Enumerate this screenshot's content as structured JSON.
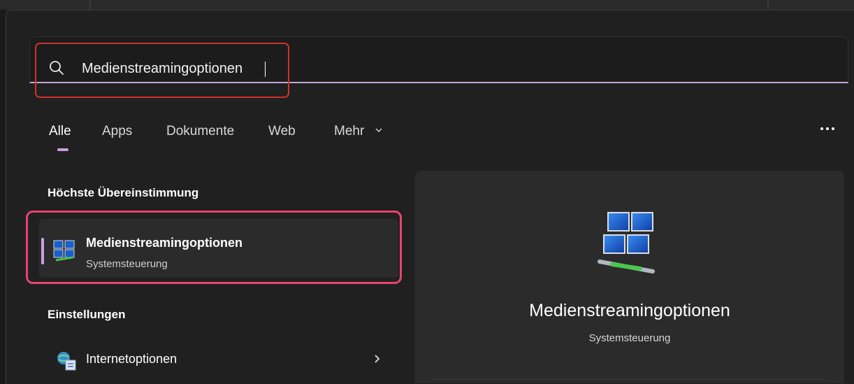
{
  "search": {
    "query": "Medienstreamingoptionen",
    "icon": "search-icon"
  },
  "tabs": [
    {
      "label": "Alle",
      "active": true
    },
    {
      "label": "Apps"
    },
    {
      "label": "Dokumente"
    },
    {
      "label": "Web"
    },
    {
      "label": "Mehr"
    }
  ],
  "more_options_icon": "more-icon",
  "best_match": {
    "heading": "Höchste Übereinstimmung",
    "title": "Medienstreamingoptionen",
    "subtitle": "Systemsteuerung",
    "icon": "network-computers-icon"
  },
  "settings": {
    "heading": "Einstellungen",
    "items": [
      {
        "label": "Internetoptionen",
        "icon": "internet-options-icon"
      }
    ]
  },
  "preview": {
    "title": "Medienstreamingoptionen",
    "subtitle": "Systemsteuerung",
    "icon": "network-computers-icon"
  },
  "colors": {
    "accent": "#c7a0e0",
    "annotation_red": "#d0312d",
    "annotation_pink": "#e8436d",
    "background": "#202020"
  }
}
